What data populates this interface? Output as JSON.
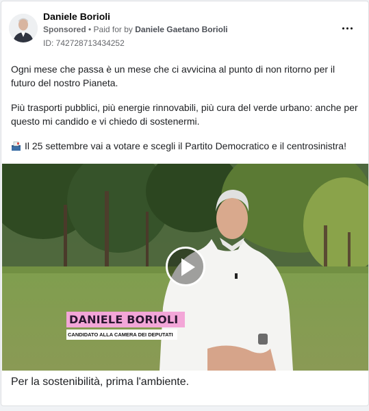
{
  "post": {
    "page_name": "Daniele Borioli",
    "sponsored_label": "Sponsored",
    "separator": " • ",
    "paid_for_prefix": "Paid for by ",
    "paid_for_by": "Daniele Gaetano Borioli",
    "ad_id": "ID: 742728713434252",
    "more_icon": "more-horizontal-icon",
    "body": {
      "paragraph_1": "Ogni mese che passa è un mese che ci avvicina al punto di non ritorno per il futuro del nostro Pianeta.",
      "paragraph_2": "Più trasporti pubblici, più energie rinnovabili, più cura del verde urbano: anche per questo mi candido e vi chiedo di sostenermi.",
      "paragraph_3_icon": "ballot-box-icon",
      "paragraph_3": "Il 25 settembre vai a votare e scegli il Partito Democratico e il centrosinistra!"
    },
    "video": {
      "play_icon": "play-icon",
      "lower_third_name": "DANIELE BORIOLI",
      "lower_third_role": "CANDIDATO ALLA CAMERA DEI DEPUTATI",
      "lower_third_color": "#f3a6d8"
    },
    "caption": "Per la sostenibilità, prima l'ambiente."
  },
  "colors": {
    "card_bg": "#ffffff",
    "page_bg": "#f0f2f5",
    "secondary_text": "#65676b"
  }
}
